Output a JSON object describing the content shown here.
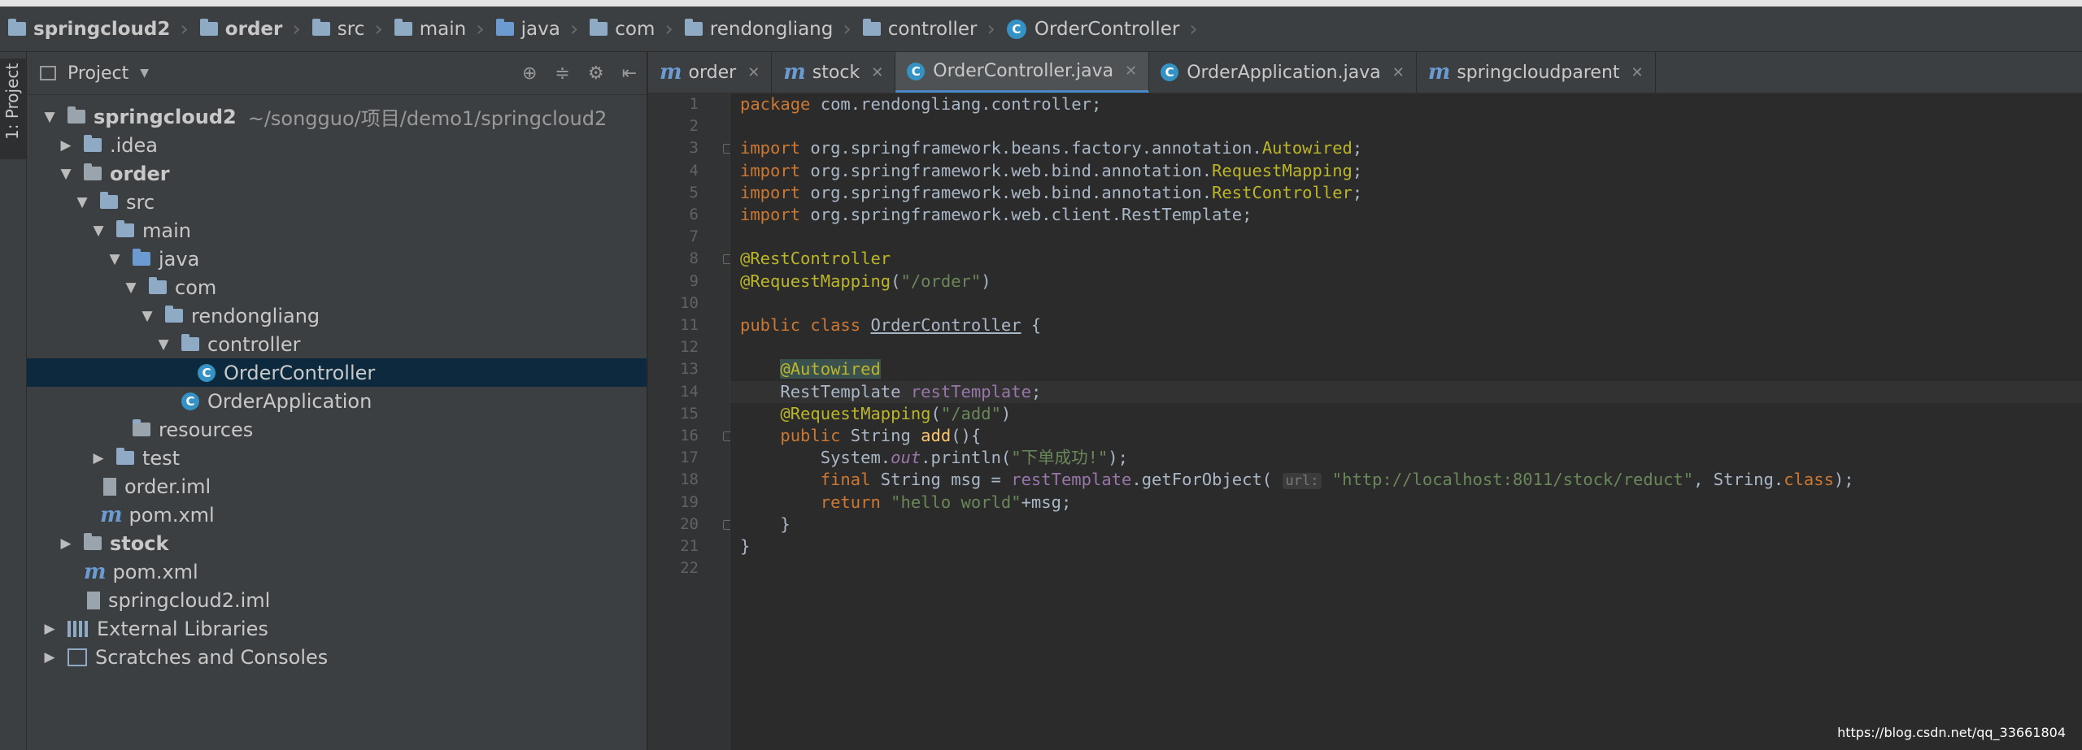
{
  "breadcrumb": [
    {
      "label": "springcloud2",
      "icon": "module-folder-icon",
      "bold": true
    },
    {
      "label": "order",
      "icon": "module-folder-icon",
      "bold": true
    },
    {
      "label": "src",
      "icon": "folder-icon"
    },
    {
      "label": "main",
      "icon": "folder-icon"
    },
    {
      "label": "java",
      "icon": "source-folder-icon"
    },
    {
      "label": "com",
      "icon": "package-icon"
    },
    {
      "label": "rendongliang",
      "icon": "package-icon"
    },
    {
      "label": "controller",
      "icon": "package-icon"
    },
    {
      "label": "OrderController",
      "icon": "class-icon"
    }
  ],
  "sidebar": {
    "tab_label": "1: Project"
  },
  "project": {
    "title": "Project",
    "tree": [
      {
        "label": "springcloud2",
        "path": "~/songguo/项目/demo1/springcloud2",
        "depth": 0,
        "arrow": "down",
        "icon": "module",
        "bold": true
      },
      {
        "label": ".idea",
        "depth": 1,
        "arrow": "right",
        "icon": "folder"
      },
      {
        "label": "order",
        "depth": 1,
        "arrow": "down",
        "icon": "module",
        "bold": true
      },
      {
        "label": "src",
        "depth": 2,
        "arrow": "down",
        "icon": "folder"
      },
      {
        "label": "main",
        "depth": 3,
        "arrow": "down",
        "icon": "folder"
      },
      {
        "label": "java",
        "depth": 4,
        "arrow": "down",
        "icon": "source"
      },
      {
        "label": "com",
        "depth": 5,
        "arrow": "down",
        "icon": "package"
      },
      {
        "label": "rendongliang",
        "depth": 6,
        "arrow": "down",
        "icon": "package"
      },
      {
        "label": "controller",
        "depth": 7,
        "arrow": "down",
        "icon": "package"
      },
      {
        "label": "OrderController",
        "depth": 8,
        "arrow": "none",
        "icon": "class",
        "selected": true
      },
      {
        "label": "OrderApplication",
        "depth": 7,
        "arrow": "none",
        "icon": "app-class"
      },
      {
        "label": "resources",
        "depth": 4,
        "arrow": "none",
        "icon": "resources"
      },
      {
        "label": "test",
        "depth": 3,
        "arrow": "right",
        "icon": "folder"
      },
      {
        "label": "order.iml",
        "depth": 2,
        "arrow": "none",
        "icon": "file"
      },
      {
        "label": "pom.xml",
        "depth": 2,
        "arrow": "none",
        "icon": "maven"
      },
      {
        "label": "stock",
        "depth": 1,
        "arrow": "right",
        "icon": "module",
        "bold": true
      },
      {
        "label": "pom.xml",
        "depth": 1,
        "arrow": "none",
        "icon": "maven"
      },
      {
        "label": "springcloud2.iml",
        "depth": 1,
        "arrow": "none",
        "icon": "file"
      },
      {
        "label": "External Libraries",
        "depth": 0,
        "arrow": "right",
        "icon": "library"
      },
      {
        "label": "Scratches and Consoles",
        "depth": 0,
        "arrow": "right",
        "icon": "scratch"
      }
    ]
  },
  "tabs": [
    {
      "label": "order",
      "icon": "maven-icon",
      "active": false
    },
    {
      "label": "stock",
      "icon": "maven-icon",
      "active": false
    },
    {
      "label": "OrderController.java",
      "icon": "class-icon",
      "active": true
    },
    {
      "label": "OrderApplication.java",
      "icon": "app-class-icon",
      "active": false
    },
    {
      "label": "springcloudparent",
      "icon": "maven-icon",
      "active": false,
      "closable": true
    }
  ],
  "editor": {
    "caret_line": 14,
    "lines": [
      [
        [
          "kw",
          "package "
        ],
        [
          "",
          "com.rendongliang.controller;"
        ]
      ],
      [],
      [
        [
          "kw",
          "import "
        ],
        [
          "",
          "org.springframework.beans.factory.annotation."
        ],
        [
          "ann",
          "Autowired"
        ],
        [
          "",
          ";"
        ]
      ],
      [
        [
          "kw",
          "import "
        ],
        [
          "",
          "org.springframework.web.bind.annotation."
        ],
        [
          "ann",
          "RequestMapping"
        ],
        [
          "",
          ";"
        ]
      ],
      [
        [
          "kw",
          "import "
        ],
        [
          "",
          "org.springframework.web.bind.annotation."
        ],
        [
          "ann",
          "RestController"
        ],
        [
          "",
          ";"
        ]
      ],
      [
        [
          "kw",
          "import "
        ],
        [
          "",
          "org.springframework.web.client.RestTemplate;"
        ]
      ],
      [],
      [
        [
          "ann",
          "@RestController"
        ]
      ],
      [
        [
          "ann",
          "@RequestMapping"
        ],
        [
          "",
          "("
        ],
        [
          "str",
          "\"/order\""
        ],
        [
          "",
          ")"
        ]
      ],
      [],
      [
        [
          "kw",
          "public class "
        ],
        [
          "uline",
          "OrderController"
        ],
        [
          "",
          " {"
        ]
      ],
      [],
      [
        [
          "",
          "    "
        ],
        [
          "ann ann-hl",
          "@Autowired"
        ]
      ],
      [
        [
          "",
          "    RestTemplate "
        ],
        [
          "fld",
          "restTemplate"
        ],
        [
          "",
          ";"
        ]
      ],
      [
        [
          "",
          "    "
        ],
        [
          "ann",
          "@RequestMapping"
        ],
        [
          "",
          "("
        ],
        [
          "str",
          "\"/add\""
        ],
        [
          "",
          ")"
        ]
      ],
      [
        [
          "kw",
          "    public "
        ],
        [
          "",
          "String "
        ],
        [
          "mth",
          "add"
        ],
        [
          "",
          "(){"
        ]
      ],
      [
        [
          "",
          "        System."
        ],
        [
          "it",
          "out"
        ],
        [
          "",
          ".println("
        ],
        [
          "str",
          "\"下单成功!\""
        ],
        [
          "",
          ");"
        ]
      ],
      [
        [
          "kw",
          "        final "
        ],
        [
          "",
          "String msg = "
        ],
        [
          "fld",
          "restTemplate"
        ],
        [
          "",
          ".getForObject( "
        ],
        [
          "hint",
          "url:"
        ],
        [
          "str",
          " \"http://localhost:8011/stock/reduct\""
        ],
        [
          "",
          ", String."
        ],
        [
          "kw",
          "class"
        ],
        [
          "",
          ");"
        ]
      ],
      [
        [
          "kw",
          "        return "
        ],
        [
          "str",
          "\"hello world\""
        ],
        [
          "",
          "+msg;"
        ]
      ],
      [
        [
          "",
          "    }"
        ]
      ],
      [
        [
          "",
          "}"
        ]
      ],
      []
    ]
  },
  "watermark": "https://blog.csdn.net/qq_33661804"
}
